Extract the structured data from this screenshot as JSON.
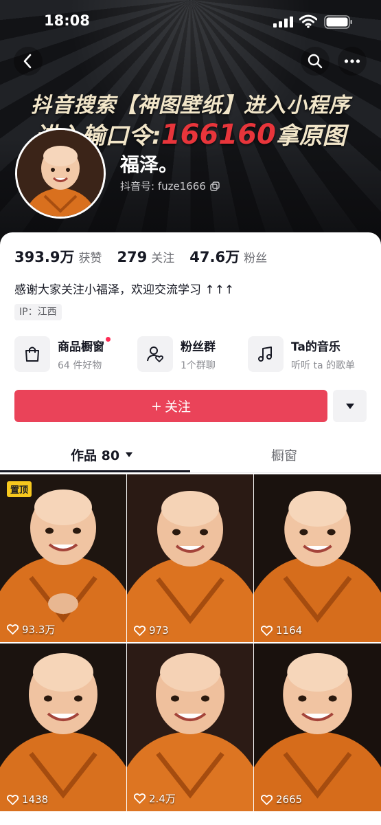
{
  "status_bar": {
    "time": "18:08"
  },
  "header": {
    "promo_line1": "抖音搜索【神图壁纸】进入小程序",
    "promo_line2_prefix": "进入输口令:",
    "promo_code": "166160",
    "promo_line2_suffix": "拿原图",
    "back_icon": "chevron-left-icon",
    "search_icon": "search-icon",
    "more_icon": "ellipsis-icon"
  },
  "profile": {
    "name": "福泽。",
    "douyin_id": "抖音号: fuze1666",
    "stats": [
      {
        "value": "393.9万",
        "label": "获赞"
      },
      {
        "value": "279",
        "label": "关注"
      },
      {
        "value": "47.6万",
        "label": "粉丝"
      }
    ],
    "bio": "感谢大家关注小福泽，欢迎交流学习 ↑↑↑",
    "ip": "IP：江西"
  },
  "shortcuts": [
    {
      "title": "商品橱窗",
      "subtitle": "64 件好物",
      "icon": "shopping-bag-icon"
    },
    {
      "title": "粉丝群",
      "subtitle": "1个群聊",
      "icon": "fan-group-icon"
    },
    {
      "title": "Ta的音乐",
      "subtitle": "听听 ta 的歌单",
      "icon": "music-note-icon"
    }
  ],
  "actions": {
    "follow_label": "关注",
    "follow_prefix": "+"
  },
  "tabs": [
    {
      "label": "作品 80",
      "active": true
    },
    {
      "label": "橱窗",
      "active": false
    }
  ],
  "videos": [
    {
      "likes": "93.3万",
      "pinned_label": "置顶"
    },
    {
      "likes": "973"
    },
    {
      "likes": "1164"
    },
    {
      "likes": "1438"
    },
    {
      "likes": "2.4万"
    },
    {
      "likes": "2665"
    }
  ],
  "colors": {
    "accent": "#ea4359",
    "pin_badge": "#f7c81e",
    "robe": "#d9701e"
  }
}
